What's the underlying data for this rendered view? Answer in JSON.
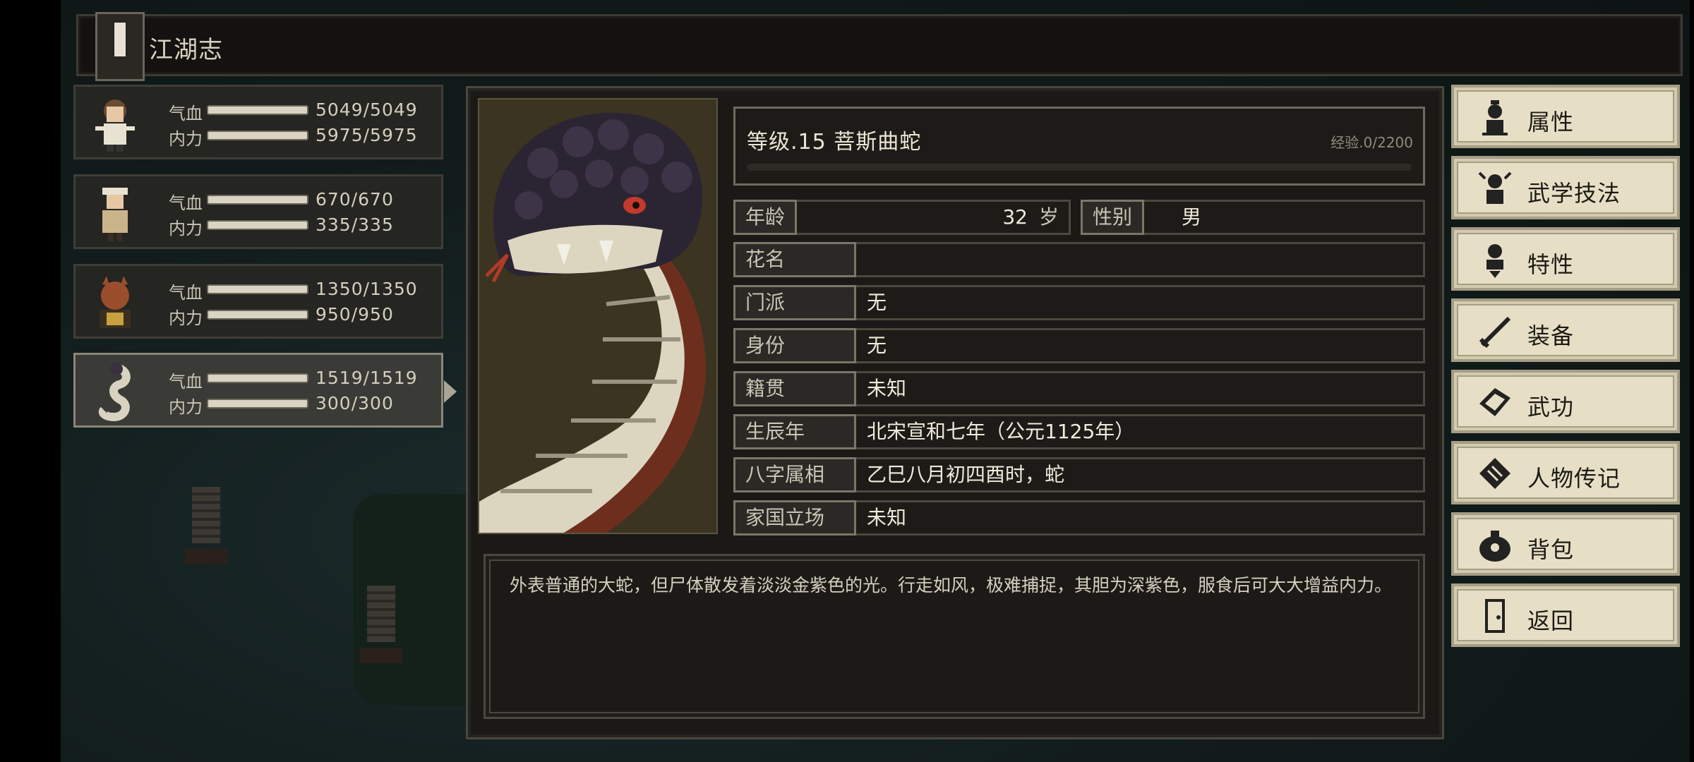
{
  "header": {
    "title": "江湖志"
  },
  "party": [
    {
      "hp_label": "气血",
      "mp_label": "内力",
      "hp": "5049/5049",
      "mp": "5975/5975",
      "selected": false
    },
    {
      "hp_label": "气血",
      "mp_label": "内力",
      "hp": "670/670",
      "mp": "335/335",
      "selected": false
    },
    {
      "hp_label": "气血",
      "mp_label": "内力",
      "hp": "1350/1350",
      "mp": "950/950",
      "selected": false
    },
    {
      "hp_label": "气血",
      "mp_label": "内力",
      "hp": "1519/1519",
      "mp": "300/300",
      "selected": true
    }
  ],
  "character": {
    "name_line": "等级.15 菩斯曲蛇",
    "exp": "经验.0/2200",
    "age_label": "年龄",
    "age": "32",
    "age_unit": "岁",
    "sex_label": "性别",
    "sex": "男",
    "fields": [
      {
        "label": "花名",
        "value": ""
      },
      {
        "label": "门派",
        "value": "无"
      },
      {
        "label": "身份",
        "value": "无"
      },
      {
        "label": "籍贯",
        "value": "未知"
      },
      {
        "label": "生辰年",
        "value": "北宋宣和七年（公元1125年）"
      },
      {
        "label": "八字属相",
        "value": "乙巳八月初四酉时，蛇"
      },
      {
        "label": "家国立场",
        "value": "未知"
      }
    ],
    "description": "外表普通的大蛇，但尸体散发着淡淡金紫色的光。行走如风，极难捕捉，其胆为深紫色，服食后可大大增益内力。"
  },
  "menu": [
    {
      "label": "属性",
      "icon": "person-stats-icon"
    },
    {
      "label": "武学技法",
      "icon": "person-skill-icon"
    },
    {
      "label": "特性",
      "icon": "person-trait-icon"
    },
    {
      "label": "装备",
      "icon": "sword-icon"
    },
    {
      "label": "武功",
      "icon": "martial-book-icon"
    },
    {
      "label": "人物传记",
      "icon": "scroll-icon"
    },
    {
      "label": "背包",
      "icon": "bag-icon"
    },
    {
      "label": "返回",
      "icon": "door-icon"
    }
  ]
}
